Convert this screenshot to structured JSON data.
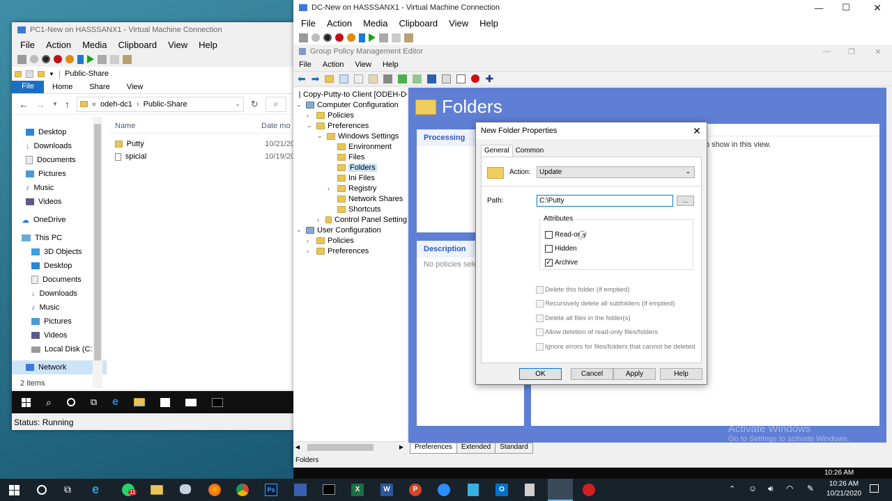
{
  "pc1_window": {
    "title": "PC1-New on HASSSANX1 - Virtual Machine Connection",
    "menu": [
      "File",
      "Action",
      "Media",
      "Clipboard",
      "View",
      "Help"
    ],
    "explorer_title": "Public-Share",
    "ribbon_tabs": [
      "File",
      "Home",
      "Share",
      "View"
    ],
    "address": [
      "odeh-dc1",
      "Public-Share"
    ],
    "nav_quick": [
      "Desktop",
      "Downloads",
      "Documents",
      "Pictures",
      "Music",
      "Videos"
    ],
    "nav_onedrive": "OneDrive",
    "nav_thispc": "This PC",
    "nav_pc_items": [
      "3D Objects",
      "Desktop",
      "Documents",
      "Downloads",
      "Music",
      "Pictures",
      "Videos",
      "Local Disk (C:)"
    ],
    "nav_network": "Network",
    "col_name": "Name",
    "col_date": "Date mo",
    "files": [
      {
        "name": "Putty",
        "date": "10/21/20"
      },
      {
        "name": "spicial",
        "date": "10/19/20"
      }
    ],
    "item_count": "2 items",
    "status": "Status: Running"
  },
  "dc_window": {
    "title": "DC-New on HASSSANX1 - Virtual Machine Connection",
    "menu": [
      "File",
      "Action",
      "Media",
      "Clipboard",
      "View",
      "Help"
    ],
    "gpm_title": "Group Policy Management Editor",
    "gpm_menu": [
      "File",
      "Action",
      "View",
      "Help"
    ],
    "tree": [
      {
        "label": "Copy-Putty-to Client [ODEH-DC",
        "level": 0,
        "exp": ""
      },
      {
        "label": "Computer Configuration",
        "level": 0,
        "exp": "v"
      },
      {
        "label": "Policies",
        "level": 1,
        "exp": ">"
      },
      {
        "label": "Preferences",
        "level": 1,
        "exp": "v"
      },
      {
        "label": "Windows Settings",
        "level": 2,
        "exp": "v"
      },
      {
        "label": "Environment",
        "level": 3,
        "exp": ""
      },
      {
        "label": "Files",
        "level": 3,
        "exp": ""
      },
      {
        "label": "Folders",
        "level": 3,
        "exp": ""
      },
      {
        "label": "Ini Files",
        "level": 3,
        "exp": ""
      },
      {
        "label": "Registry",
        "level": 3,
        "exp": ">"
      },
      {
        "label": "Network Shares",
        "level": 3,
        "exp": ""
      },
      {
        "label": "Shortcuts",
        "level": 3,
        "exp": ""
      },
      {
        "label": "Control Panel Setting",
        "level": 2,
        "exp": ">"
      },
      {
        "label": "User Configuration",
        "level": 0,
        "exp": "v"
      },
      {
        "label": "Policies",
        "level": 1,
        "exp": ">"
      },
      {
        "label": "Preferences",
        "level": 1,
        "exp": ">"
      }
    ],
    "folders_heading": "Folders",
    "processing": "Processing",
    "description": "Description",
    "no_policies": "No policies selec",
    "show_text": "o show in this view.",
    "bottom_tabs": [
      "Preferences",
      "Extended",
      "Standard"
    ],
    "status": "Folders",
    "watermark_1": "Activate Windows",
    "watermark_2": "Go to Settings to activate Windows."
  },
  "dialog": {
    "title": "New Folder Properties",
    "tabs": [
      "General",
      "Common"
    ],
    "action_label": "Action:",
    "action_value": "Update",
    "path_label": "Path:",
    "path_value": "C:\\Putty",
    "browse": "...",
    "attributes_title": "Attributes",
    "attributes": [
      {
        "label": "Read-only",
        "checked": false
      },
      {
        "label": "Hidden",
        "checked": false
      },
      {
        "label": "Archive",
        "checked": true
      }
    ],
    "options": [
      "Delete this folder (if emptied)",
      "Recursively delete all subfolders (if emptied)",
      "Delete all files in the folder(s)",
      "Allow deletion of read-only files/folders",
      "Ignore errors for files/folders that cannot be deleted"
    ],
    "buttons": [
      "OK",
      "Cancel",
      "Apply",
      "Help"
    ]
  },
  "taskbar": {
    "time": "10:26 AM",
    "date": "10/21/2020",
    "inner_time": "10:26 AM",
    "whatsapp_badge": "11"
  }
}
